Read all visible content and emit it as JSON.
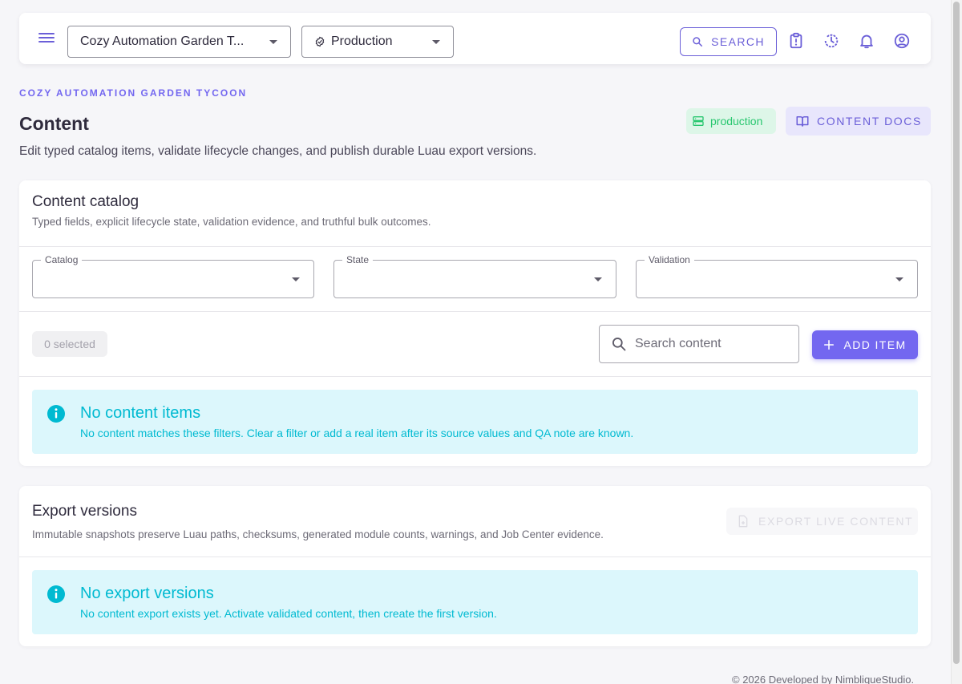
{
  "topbar": {
    "project_select": "Cozy Automation Garden T...",
    "environment_select": "Production",
    "search_label": "SEARCH"
  },
  "header": {
    "eyebrow": "COZY AUTOMATION GARDEN TYCOON",
    "title": "Content",
    "description": "Edit typed catalog items, validate lifecycle changes, and publish durable Luau export versions.",
    "env_badge": "production",
    "docs_button": "CONTENT DOCS"
  },
  "catalog_card": {
    "title": "Content catalog",
    "subtitle": "Typed fields, explicit lifecycle state, validation evidence, and truthful bulk outcomes.",
    "filters": [
      {
        "label": "Catalog",
        "value": ""
      },
      {
        "label": "State",
        "value": ""
      },
      {
        "label": "Validation",
        "value": ""
      }
    ],
    "selected_count": "0 selected",
    "search_placeholder": "Search content",
    "add_button": "ADD ITEM",
    "empty_title": "No content items",
    "empty_body": "No content matches these filters. Clear a filter or add a real item after its source values and QA note are known."
  },
  "export_card": {
    "title": "Export versions",
    "subtitle": "Immutable snapshots preserve Luau paths, checksums, generated module counts, warnings, and Job Center evidence.",
    "export_button": "EXPORT LIVE CONTENT",
    "empty_title": "No export versions",
    "empty_body": "No content export exists yet. Activate validated content, then create the first version."
  },
  "footer": {
    "text": "© 2026 Developed by NimbliqueStudio."
  },
  "colors": {
    "primary": "#7367f0",
    "success": "#28c76f",
    "info": "#00bad1",
    "info_bg": "#dcf7fc"
  },
  "icons": [
    "menu-icon",
    "check-circle-icon",
    "search-icon",
    "clipboard-alert-icon",
    "history-icon",
    "bell-icon",
    "account-circle-icon",
    "server-icon",
    "book-icon",
    "plus-icon",
    "info-icon",
    "file-export-icon"
  ]
}
